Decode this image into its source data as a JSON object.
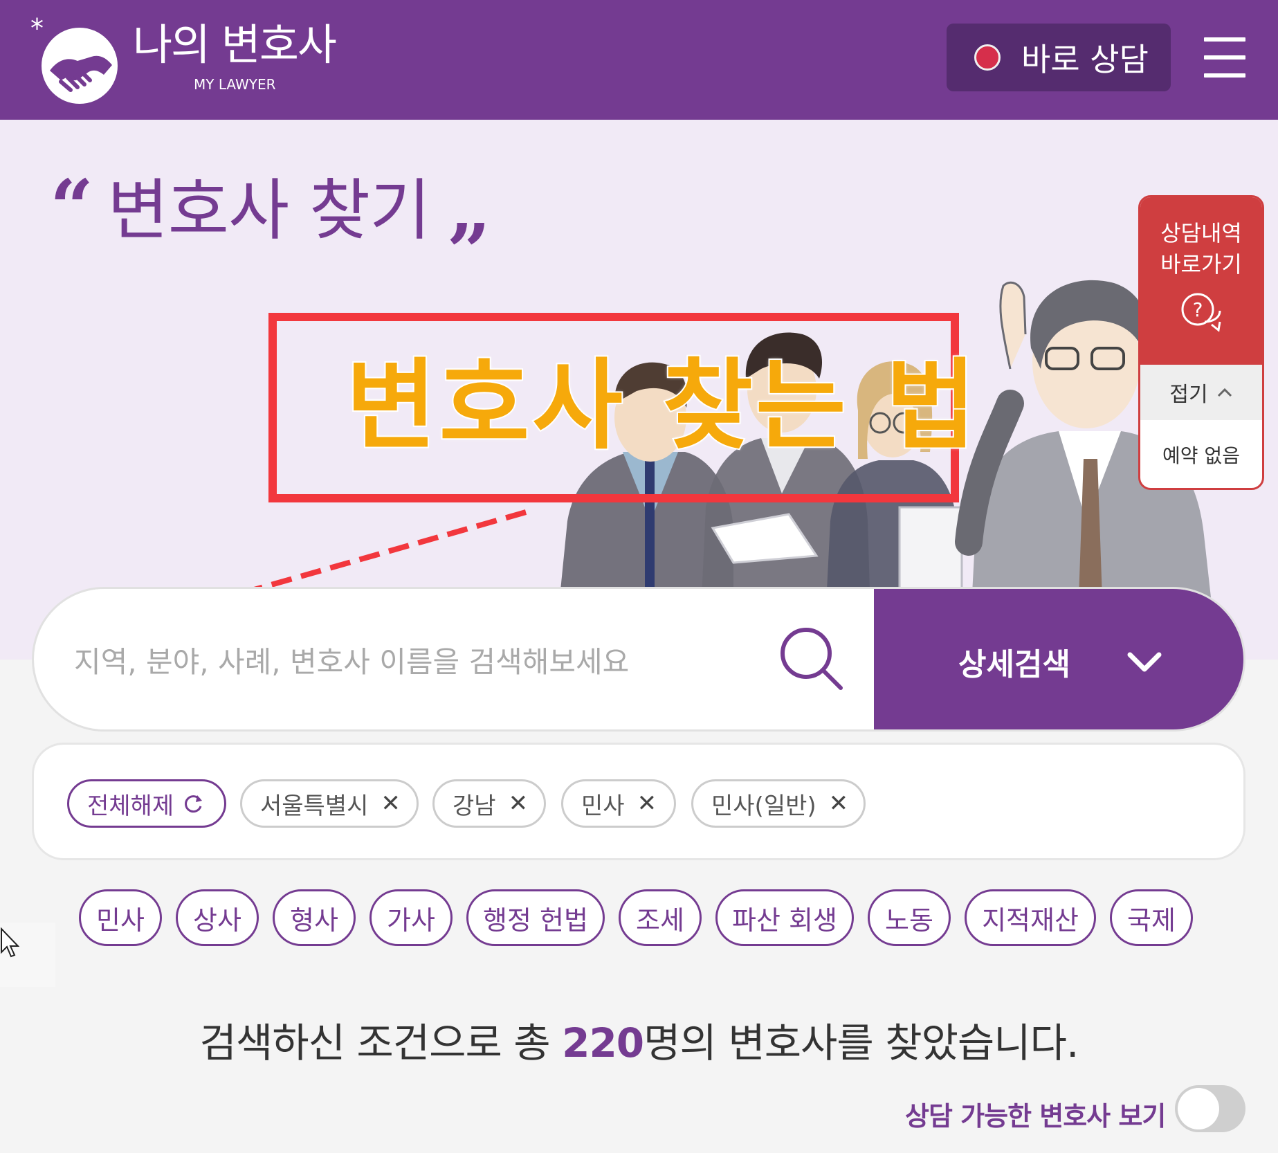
{
  "header": {
    "logo_title": "나의 변호사",
    "logo_subtitle": "MY LAWYER",
    "quick_consult_label": "바로 상담"
  },
  "hero": {
    "title": "변호사 찾기",
    "annotation": "변호사 찾는 법"
  },
  "side_panel": {
    "history_label": "상담내역\n바로가기",
    "fold_label": "접기",
    "reservation_status": "예약 없음"
  },
  "search": {
    "placeholder": "지역, 분야, 사례, 변호사 이름을 검색해보세요",
    "value": "",
    "detail_label": "상세검색"
  },
  "filters": {
    "reset_label": "전체해제",
    "chips": [
      "서울특별시",
      "강남",
      "민사",
      "민사(일반)"
    ]
  },
  "categories": [
    "민사",
    "상사",
    "형사",
    "가사",
    "행정 헌법",
    "조세",
    "파산 회생",
    "노동",
    "지적재산",
    "국제"
  ],
  "result": {
    "prefix": "검색하신 조건으로 총 ",
    "count": "220",
    "suffix": "명의 변호사를 찾았습니다."
  },
  "available_toggle": {
    "label": "상담 가능한 변호사 보기",
    "on": false
  },
  "colors": {
    "brand_purple": "#743b91",
    "header_button": "#552c6f",
    "side_panel_red": "#cf3e40",
    "annotation_red": "#f2373d",
    "annotation_text": "#f6a90b",
    "live_dot": "#d62f4b"
  }
}
